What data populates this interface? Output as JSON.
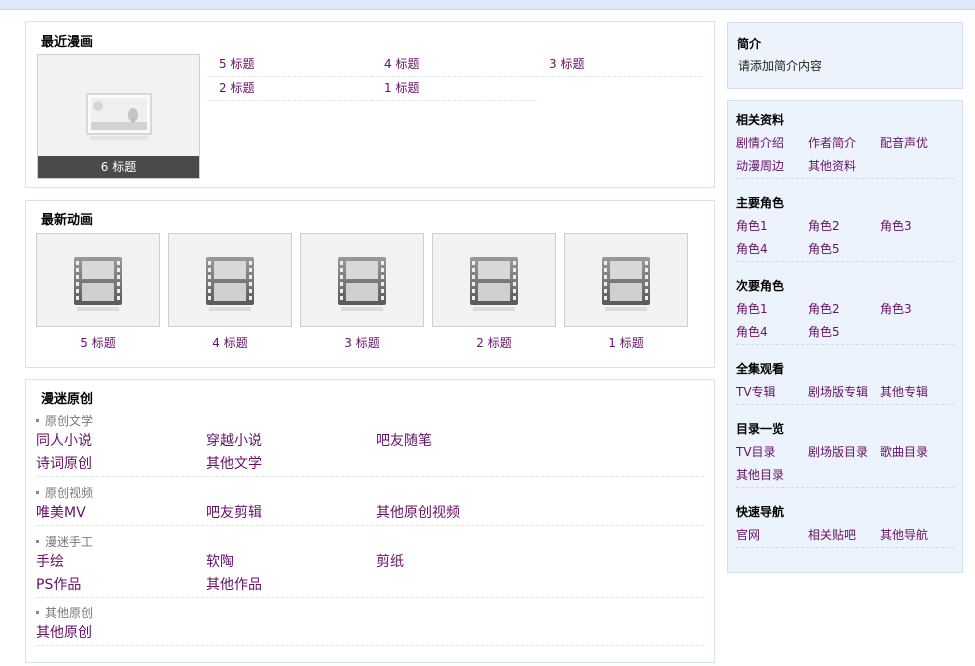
{
  "recent": {
    "title": "最近漫画",
    "featured_caption": "6 标题",
    "items": [
      "5 标题",
      "4 标题",
      "3 标题",
      "2 标题",
      "1 标题"
    ]
  },
  "anime": {
    "title": "最新动画",
    "items": [
      "5 标题",
      "4 标题",
      "3 标题",
      "2 标题",
      "1 标题"
    ]
  },
  "orig": {
    "title": "漫迷原创",
    "groups": [
      {
        "head": "原创文学",
        "links": [
          "同人小说",
          "穿越小说",
          "吧友随笔",
          "诗词原创",
          "其他文学"
        ]
      },
      {
        "head": "原创视频",
        "links": [
          "唯美MV",
          "吧友剪辑",
          "其他原创视频"
        ]
      },
      {
        "head": "漫迷手工",
        "links": [
          "手绘",
          "软陶",
          "剪纸",
          "PS作品",
          "其他作品"
        ]
      },
      {
        "head": "其他原创",
        "links": [
          "其他原创"
        ]
      }
    ]
  },
  "intro": {
    "title": "简介",
    "text": "请添加简介内容"
  },
  "side": {
    "sections": [
      {
        "title": "相关资料",
        "links": [
          "剧情介绍",
          "作者简介",
          "配音声优",
          "动漫周边",
          "其他资料"
        ]
      },
      {
        "title": "主要角色",
        "links": [
          "角色1",
          "角色2",
          "角色3",
          "角色4",
          "角色5"
        ]
      },
      {
        "title": "次要角色",
        "links": [
          "角色1",
          "角色2",
          "角色3",
          "角色4",
          "角色5"
        ]
      },
      {
        "title": "全集观看",
        "links": [
          "TV专辑",
          "剧场版专辑",
          "其他专辑"
        ]
      },
      {
        "title": "目录一览",
        "links": [
          "TV目录",
          "剧场版目录",
          "歌曲目录",
          "其他目录"
        ]
      },
      {
        "title": "快速导航",
        "links": [
          "官网",
          "相关贴吧",
          "其他导航"
        ]
      }
    ]
  },
  "colors": {
    "link": "#661166",
    "side_bg": "#edf3fc",
    "top_bar": "#dfe9fb"
  }
}
